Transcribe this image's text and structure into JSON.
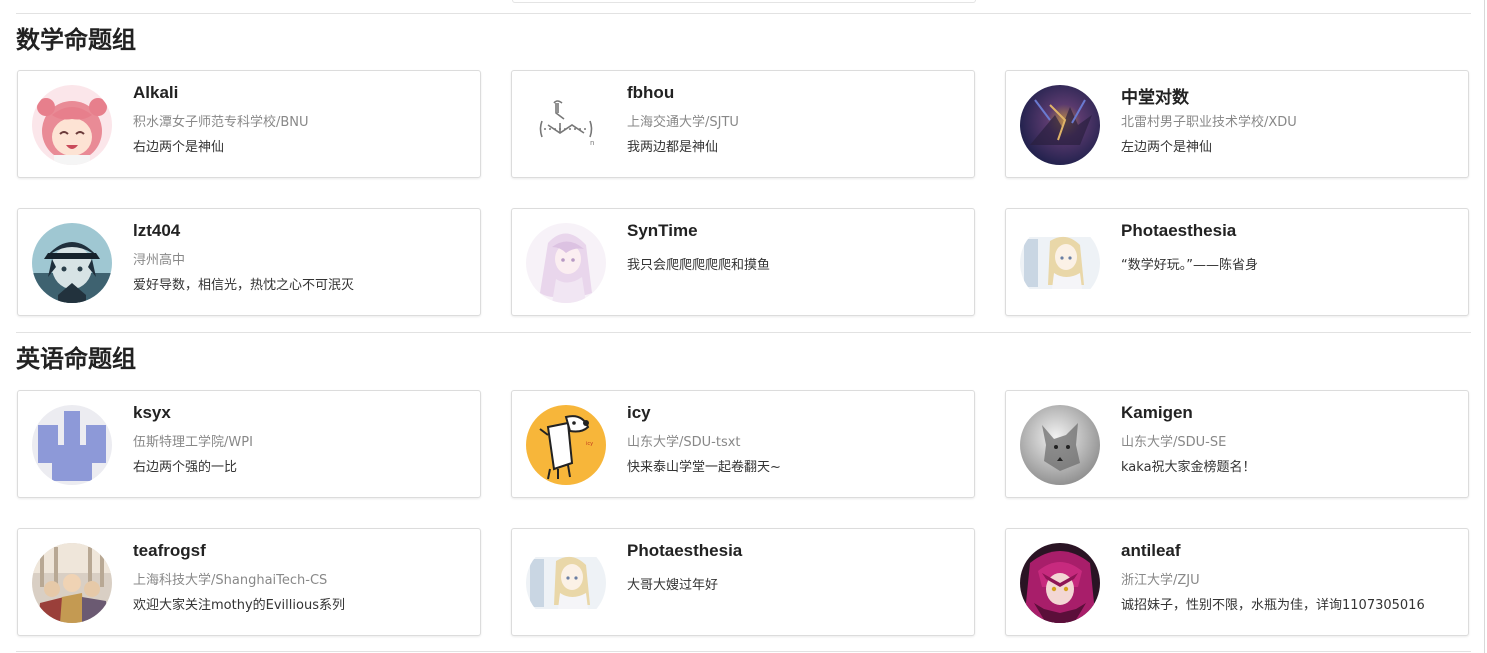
{
  "sections": [
    {
      "title": "数学命题组",
      "members": [
        {
          "name": "Alkali",
          "school": "积水潭女子师范专科学校/BNU",
          "motto": "右边两个是神仙",
          "avatar_icon": "pink-hair-anime-girl-avatar"
        },
        {
          "name": "fbhou",
          "school": "上海交通大学/SJTU",
          "motto": "我两边都是神仙",
          "avatar_icon": "polymer-structure-avatar"
        },
        {
          "name": "中堂对数",
          "school": "北雷村男子职业技术学校/XDU",
          "motto": "左边两个是神仙",
          "avatar_icon": "dark-creature-avatar"
        },
        {
          "name": "lzt404",
          "school": "浔州高中",
          "motto": "爱好导数，相信光，热忱之心不可泯灭",
          "avatar_icon": "anime-boy-cap-avatar"
        },
        {
          "name": "SynTime",
          "school": "",
          "motto": "我只会爬爬爬爬爬和摸鱼",
          "avatar_icon": "pastel-anime-girl-avatar"
        },
        {
          "name": "Photaesthesia",
          "school": "",
          "motto": "“数学好玩。”——陈省身",
          "avatar_icon": "blonde-anime-girl-avatar"
        }
      ]
    },
    {
      "title": "英语命题组",
      "members": [
        {
          "name": "ksyx",
          "school": "伍斯特理工学院/WPI",
          "motto": "右边两个强的一比",
          "avatar_icon": "blue-block-pattern-avatar"
        },
        {
          "name": "icy",
          "school": "山东大学/SDU-tsxt",
          "motto": "快来泰山学堂一起卷翻天~",
          "avatar_icon": "cartoon-dog-yellow-avatar"
        },
        {
          "name": "Kamigen",
          "school": "山东大学/SDU-SE",
          "motto": "kaka祝大家金榜题名！",
          "avatar_icon": "gray-wolf-avatar"
        },
        {
          "name": "teafrogsf",
          "school": "上海科技大学/ShanghaiTech-CS",
          "motto": "欢迎大家关注mothy的Evillious系列",
          "avatar_icon": "anime-group-illustration-avatar"
        },
        {
          "name": "Photaesthesia",
          "school": "",
          "motto": "大哥大嫂过年好",
          "avatar_icon": "blonde-anime-girl-avatar"
        },
        {
          "name": "antileaf",
          "school": "浙江大学/ZJU",
          "motto": "诚招妹子，性别不限，水瓶为佳，详询1107305016",
          "avatar_icon": "magenta-hair-anime-girl-avatar"
        }
      ]
    }
  ]
}
